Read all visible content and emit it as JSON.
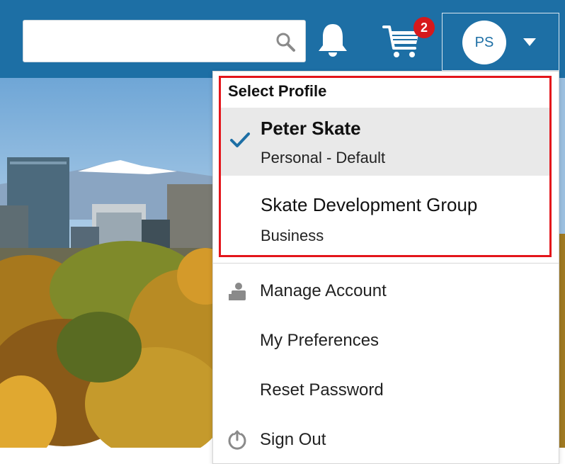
{
  "header": {
    "search": {
      "value": "",
      "placeholder": ""
    },
    "cart": {
      "badge_count": "2"
    },
    "profile": {
      "initials": "PS"
    },
    "colors": {
      "bar": "#1d6fa5",
      "badge": "#d6191c"
    }
  },
  "dropdown": {
    "section_title": "Select Profile",
    "profiles": [
      {
        "name": "Peter Skate",
        "type": "Personal - Default",
        "selected": true
      },
      {
        "name": "Skate Development Group",
        "type": "Business",
        "selected": false
      }
    ],
    "menu": [
      {
        "label": "Manage Account",
        "icon": "account-icon"
      },
      {
        "label": "My Preferences",
        "icon": ""
      },
      {
        "label": "Reset Password",
        "icon": ""
      },
      {
        "label": "Sign Out",
        "icon": "power-icon"
      }
    ],
    "colors": {
      "highlight": "#e3151b",
      "check": "#1d6fa5"
    }
  }
}
